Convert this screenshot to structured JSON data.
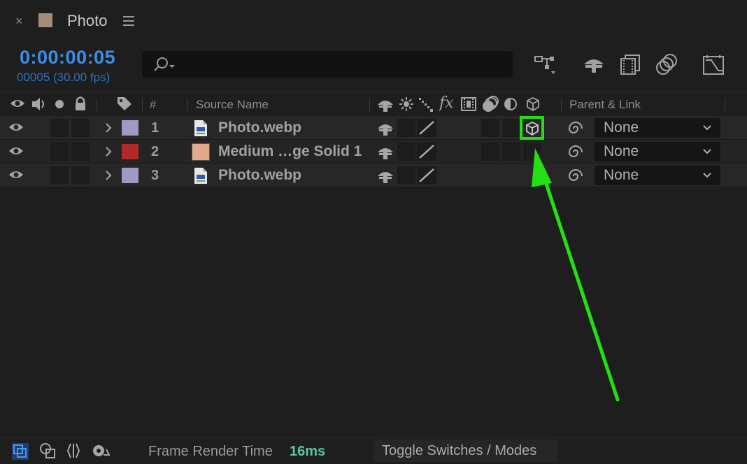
{
  "window": {
    "close_glyph": "×",
    "title": "Photo",
    "comp_color": "#a28e76"
  },
  "timecode": {
    "time": "0:00:00:05",
    "frames": "00005 (30.00 fps)"
  },
  "search": {
    "placeholder": ""
  },
  "toolbar": {
    "icons": [
      "comp-flowchart-icon",
      "draft-3d-icon",
      "frame-blending-icon",
      "motion-blur-icon",
      "graph-editor-icon"
    ]
  },
  "header": {
    "hash": "#",
    "source_name": "Source Name",
    "fx": "fx",
    "parent_link": "Parent & Link"
  },
  "layers": [
    {
      "num": "1",
      "name": "Photo.webp",
      "label_color": "#9e9ac4",
      "type": "file",
      "parent": "None",
      "three_d": true
    },
    {
      "num": "2",
      "name": "Medium …ge Solid 1",
      "label_color": "#b02a2a",
      "type": "solid",
      "solid_color": "#e2a98c",
      "parent": "None",
      "three_d": false
    },
    {
      "num": "3",
      "name": "Photo.webp",
      "label_color": "#9e9ac4",
      "type": "file",
      "parent": "None",
      "three_d": false
    }
  ],
  "annotation": {
    "highlight_color": "#22e011",
    "arrow_color": "#22e011"
  },
  "bottom": {
    "frame_render_label": "Frame Render Time",
    "frame_render_value": "16ms",
    "toggle_label": "Toggle Switches / Modes",
    "accent_color": "#56c8a6"
  }
}
